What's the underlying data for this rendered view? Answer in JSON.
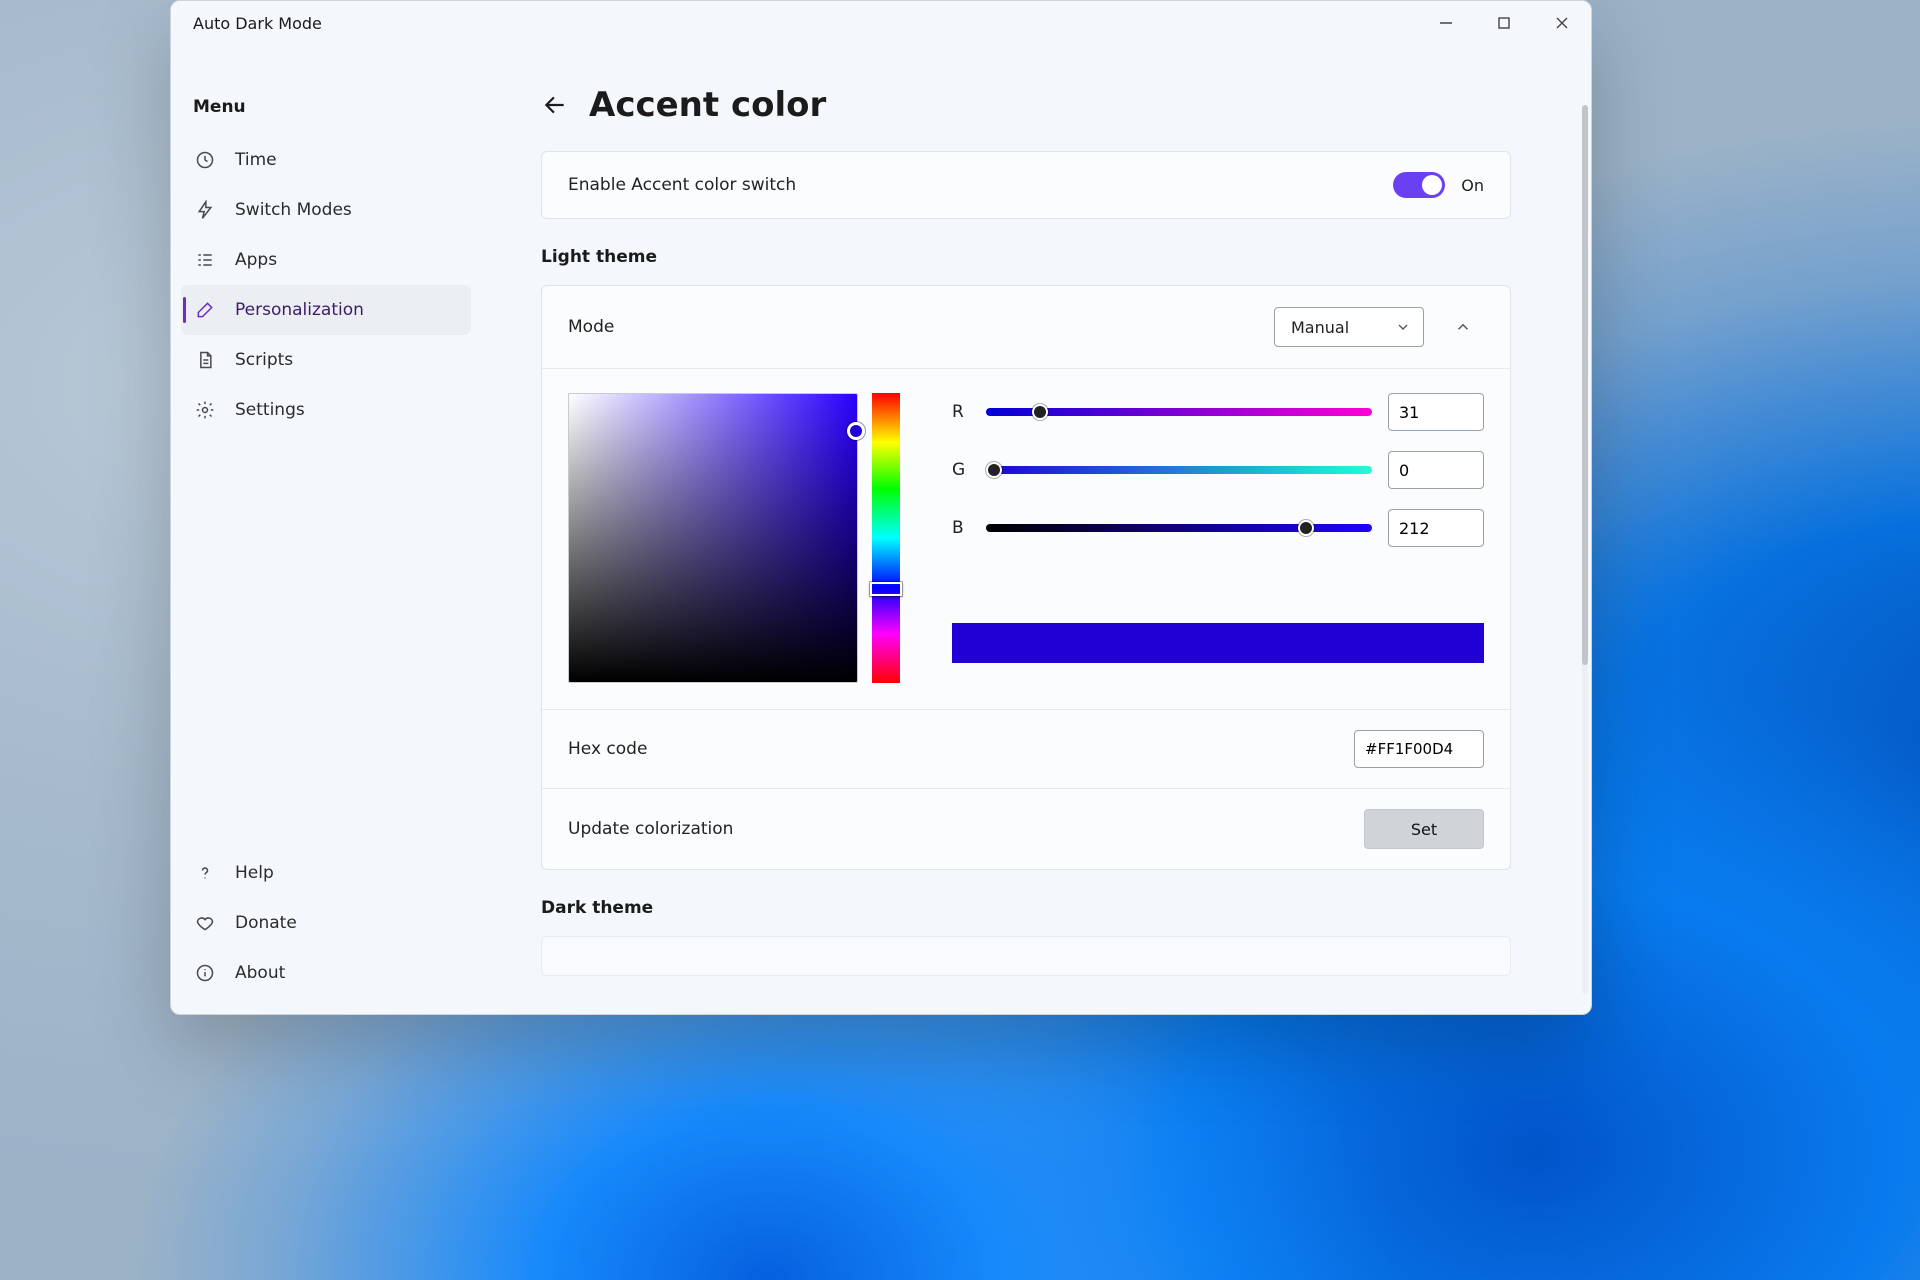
{
  "app_title": "Auto Dark Mode",
  "sidebar": {
    "menu_label": "Menu",
    "items": [
      {
        "label": "Time",
        "icon": "clock-icon",
        "selected": false
      },
      {
        "label": "Switch Modes",
        "icon": "bolt-icon",
        "selected": false
      },
      {
        "label": "Apps",
        "icon": "list-icon",
        "selected": false
      },
      {
        "label": "Personalization",
        "icon": "brush-icon",
        "selected": true
      },
      {
        "label": "Scripts",
        "icon": "document-icon",
        "selected": false
      },
      {
        "label": "Settings",
        "icon": "gear-icon",
        "selected": false
      }
    ],
    "footer": [
      {
        "label": "Help",
        "icon": "help-icon"
      },
      {
        "label": "Donate",
        "icon": "heart-icon"
      },
      {
        "label": "About",
        "icon": "info-icon"
      }
    ]
  },
  "page": {
    "title": "Accent color",
    "toggle": {
      "label": "Enable Accent color switch",
      "state_label": "On",
      "on": true
    },
    "sections": {
      "light": {
        "title": "Light theme",
        "mode_label": "Mode",
        "mode_value": "Manual",
        "expanded": true,
        "rgb": {
          "r": 31,
          "g": 0,
          "b": 212,
          "r_pct": 14,
          "g_pct": 2,
          "b_pct": 83
        },
        "preview_color": "#2000D4",
        "hex_label": "Hex code",
        "hex_value": "#FF1F00D4",
        "colorize_label": "Update colorization",
        "set_label": "Set"
      },
      "dark": {
        "title": "Dark theme"
      }
    }
  }
}
